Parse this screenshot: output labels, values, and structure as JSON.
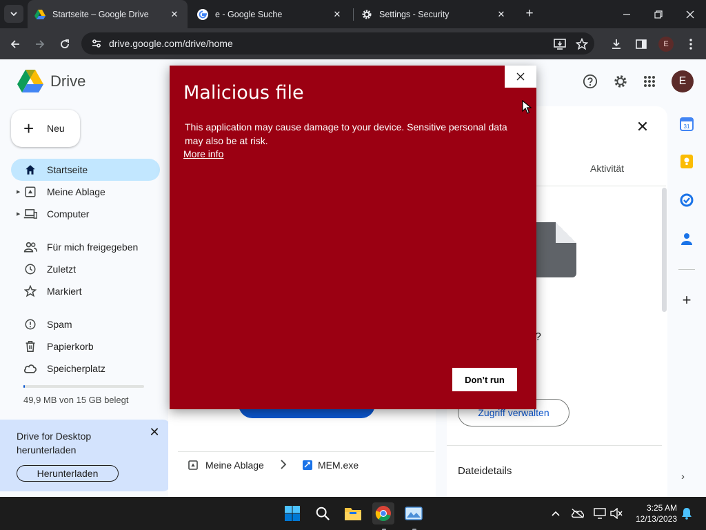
{
  "browser": {
    "tabs": [
      {
        "title": "Startseite – Google Drive",
        "active": true,
        "icon": "google-drive-icon"
      },
      {
        "title": "e - Google Suche",
        "active": false,
        "icon": "google-g-icon"
      },
      {
        "title": "Settings - Security",
        "active": false,
        "icon": "gear-icon"
      }
    ],
    "url": "drive.google.com/drive/home",
    "profile_initial": "E"
  },
  "drive": {
    "logo_text": "Drive",
    "new_button": "Neu",
    "nav": [
      {
        "label": "Startseite",
        "icon": "home-icon",
        "active": true
      },
      {
        "label": "Meine Ablage",
        "icon": "my-drive-icon",
        "expandable": true
      },
      {
        "label": "Computer",
        "icon": "computer-icon",
        "expandable": true
      },
      {
        "label": "Für mich freigegeben",
        "icon": "people-icon"
      },
      {
        "label": "Zuletzt",
        "icon": "clock-icon"
      },
      {
        "label": "Markiert",
        "icon": "star-icon"
      },
      {
        "label": "Spam",
        "icon": "spam-icon"
      },
      {
        "label": "Papierkorb",
        "icon": "trash-icon"
      },
      {
        "label": "Speicherplatz",
        "icon": "cloud-icon"
      }
    ],
    "storage": {
      "text": "49,9 MB von 15 GB belegt",
      "fraction": 0.003
    },
    "promo": {
      "text": "Drive for Desktop herunterladen",
      "button": "Herunterladen"
    },
    "breadcrumb": {
      "folder": "Meine Ablage",
      "file": "MEM.exe"
    },
    "details_panel": {
      "tab_label": "Aktivität",
      "question_fragment": "?",
      "manage_access_button": "Zugriff verwalten",
      "section_title": "Dateidetails"
    },
    "avatar_initial": "E"
  },
  "dialog": {
    "title": "Malicious file",
    "message": "This application may cause damage to your device. Sensitive personal data may also be at risk.",
    "more_info": "More info",
    "dont_run_button": "Don’t run",
    "background_color": "#9b0012"
  },
  "taskbar": {
    "time": "3:25 AM",
    "date": "12/13/2023",
    "apps": [
      "windows-start-icon",
      "search-icon",
      "file-explorer-icon",
      "chrome-icon",
      "photos-app-icon"
    ]
  }
}
